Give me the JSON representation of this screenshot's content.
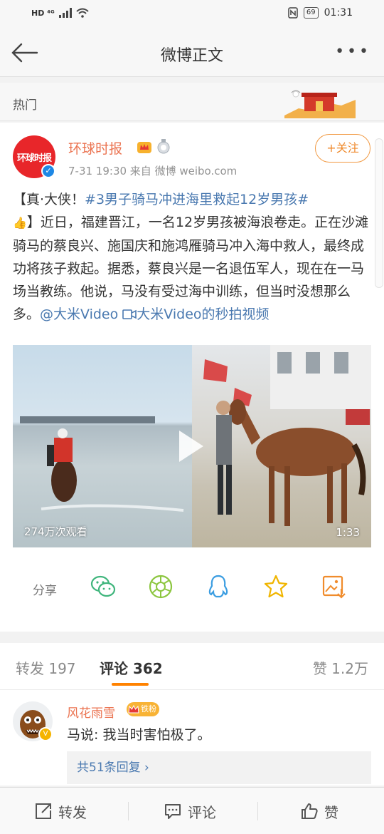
{
  "status_bar": {
    "left_indicators": "HD ⁴ᴳ",
    "battery": "69",
    "time": "01:31"
  },
  "nav": {
    "title": "微博正文"
  },
  "hot": {
    "label": "热门"
  },
  "post": {
    "avatar_text": "环球时报",
    "author": "环球时报",
    "meta": "7-31 19:30  来自 微博 weibo.com",
    "follow_label": "+关注",
    "content": {
      "p1": "【真·大侠！",
      "hashtag": "#3男子骑马冲进海里救起12岁男孩#",
      "p2": "】近日，福建晋江，一名12岁男孩被海浪卷走。正在沙滩骑马的蔡良兴、施国庆和施鸿雁骑马冲入海中救人，最终成功将孩子救起。据悉，蔡良兴是一名退伍军人，现在在一马场当教练。他说，马没有受过海中训练，但当时没想那么多。",
      "mention": "@大米Video",
      "video_link": "大米Video的秒拍视频"
    },
    "video": {
      "views": "274万次观看",
      "duration": "1:33"
    },
    "share": {
      "label": "分享",
      "targets": [
        "wechat-icon",
        "moments-icon",
        "qq-icon",
        "qzone-icon",
        "save-image-icon"
      ]
    }
  },
  "tabs": {
    "repost": "转发 197",
    "comments": "评论 362",
    "likes": "赞 1.2万"
  },
  "comment": {
    "name": "风花雨雪",
    "fan_badge": "铁粉",
    "text": "马说: 我当时害怕极了。",
    "replies": "共51条回复 ›"
  },
  "bottom_bar": {
    "repost": "转发",
    "comment": "评论",
    "like": "赞"
  },
  "colors": {
    "accent_orange": "#ff8200",
    "author_name": "#eb7350",
    "link_blue": "#4a79b0"
  }
}
